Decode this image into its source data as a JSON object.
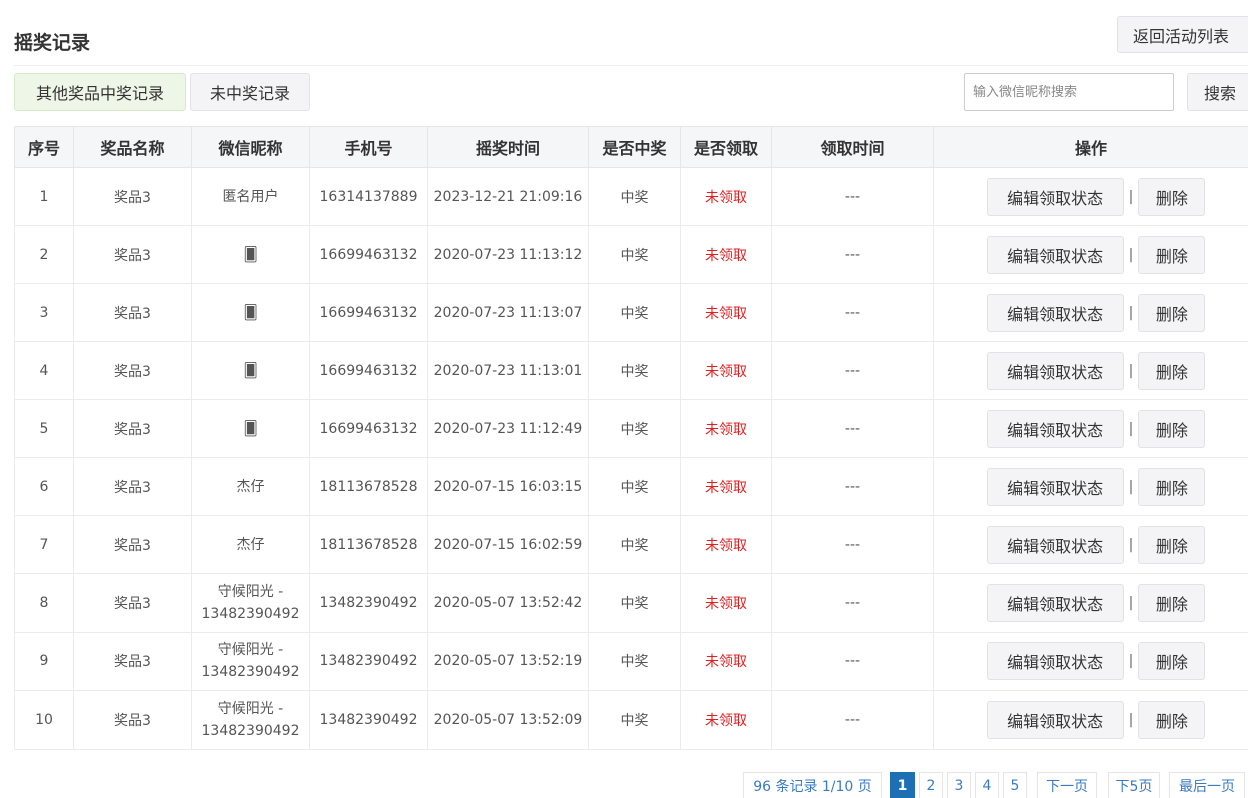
{
  "header": {
    "title": "摇奖记录",
    "back_label": "返回活动列表"
  },
  "tabs": [
    {
      "label": "其他奖品中奖记录",
      "active": true
    },
    {
      "label": "未中奖记录",
      "active": false
    }
  ],
  "search": {
    "placeholder": "输入微信昵称搜索",
    "value": "",
    "button_label": "搜索"
  },
  "table": {
    "columns": [
      "序号",
      "奖品名称",
      "微信昵称",
      "手机号",
      "摇奖时间",
      "是否中奖",
      "是否领取",
      "领取时间",
      "操作"
    ],
    "rows": [
      {
        "index": "1",
        "prize": "奖品3",
        "nickname": "匿名用户",
        "phone": "16314137889",
        "time": "2023-12-21 21:09:16",
        "won": "中奖",
        "claimed": "未领取",
        "claim_time": "---"
      },
      {
        "index": "2",
        "prize": "奖品3",
        "nickname": "🂠",
        "phone": "16699463132",
        "time": "2020-07-23 11:13:12",
        "won": "中奖",
        "claimed": "未领取",
        "claim_time": "---"
      },
      {
        "index": "3",
        "prize": "奖品3",
        "nickname": "🂠",
        "phone": "16699463132",
        "time": "2020-07-23 11:13:07",
        "won": "中奖",
        "claimed": "未领取",
        "claim_time": "---"
      },
      {
        "index": "4",
        "prize": "奖品3",
        "nickname": "🂠",
        "phone": "16699463132",
        "time": "2020-07-23 11:13:01",
        "won": "中奖",
        "claimed": "未领取",
        "claim_time": "---"
      },
      {
        "index": "5",
        "prize": "奖品3",
        "nickname": "🂠",
        "phone": "16699463132",
        "time": "2020-07-23 11:12:49",
        "won": "中奖",
        "claimed": "未领取",
        "claim_time": "---"
      },
      {
        "index": "6",
        "prize": "奖品3",
        "nickname": "杰仔",
        "phone": "18113678528",
        "time": "2020-07-15 16:03:15",
        "won": "中奖",
        "claimed": "未领取",
        "claim_time": "---"
      },
      {
        "index": "7",
        "prize": "奖品3",
        "nickname": "杰仔",
        "phone": "18113678528",
        "time": "2020-07-15 16:02:59",
        "won": "中奖",
        "claimed": "未领取",
        "claim_time": "---"
      },
      {
        "index": "8",
        "prize": "奖品3",
        "nickname": "守候阳光 - 13482390492",
        "phone": "13482390492",
        "time": "2020-05-07 13:52:42",
        "won": "中奖",
        "claimed": "未领取",
        "claim_time": "---"
      },
      {
        "index": "9",
        "prize": "奖品3",
        "nickname": "守候阳光 - 13482390492",
        "phone": "13482390492",
        "time": "2020-05-07 13:52:19",
        "won": "中奖",
        "claimed": "未领取",
        "claim_time": "---"
      },
      {
        "index": "10",
        "prize": "奖品3",
        "nickname": "守候阳光 - 13482390492",
        "phone": "13482390492",
        "time": "2020-05-07 13:52:09",
        "won": "中奖",
        "claimed": "未领取",
        "claim_time": "---"
      }
    ],
    "actions": {
      "edit_label": "编辑领取状态",
      "separator": "|",
      "delete_label": "删除"
    }
  },
  "pagination": {
    "info": "96 条记录 1/10 页",
    "current": "1",
    "pages": [
      "2",
      "3",
      "4",
      "5"
    ],
    "next": "下一页",
    "next5": "下5页",
    "last": "最后一页"
  },
  "colors": {
    "active_tab_bg": "#eef6e7",
    "unclaimed_text": "#e02020",
    "pager_current_bg": "#1f6fb5",
    "pager_link": "#3a7bbf"
  }
}
